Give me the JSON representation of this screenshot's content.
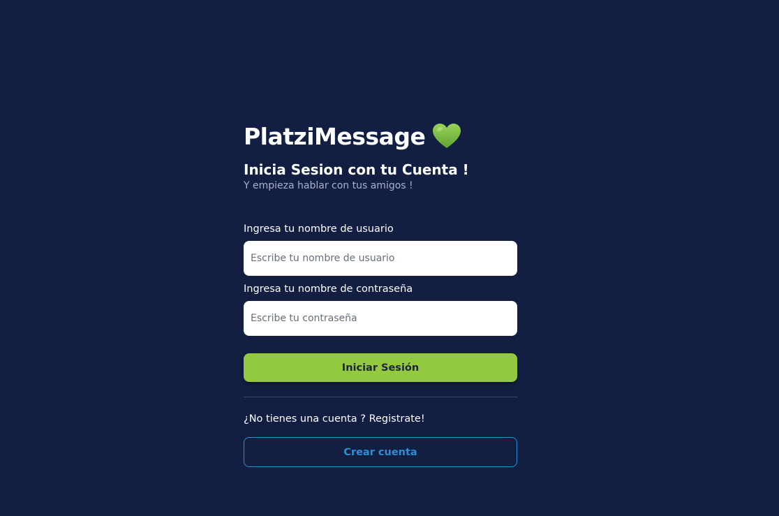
{
  "brand": {
    "title": "PlatziMessage",
    "icon": "green-heart-icon",
    "icon_color": "#7fbf3f"
  },
  "header": {
    "subtitle": "Inicia Sesion con tu Cuenta !",
    "tagline": "Y empieza hablar con tus amigos !"
  },
  "form": {
    "username": {
      "label": "Ingresa tu nombre de usuario",
      "placeholder": "Escribe tu nombre de usuario",
      "value": ""
    },
    "password": {
      "label": "Ingresa tu nombre de contraseña",
      "placeholder": "Escribe tu contraseña",
      "value": ""
    },
    "submit_label": "Iniciar Sesión"
  },
  "register": {
    "prompt": "¿No tienes una cuenta ? Registrate!",
    "button_label": "Crear cuenta"
  },
  "colors": {
    "background": "#121f42",
    "primary": "#93c93f",
    "secondary": "#2a8fd6"
  }
}
